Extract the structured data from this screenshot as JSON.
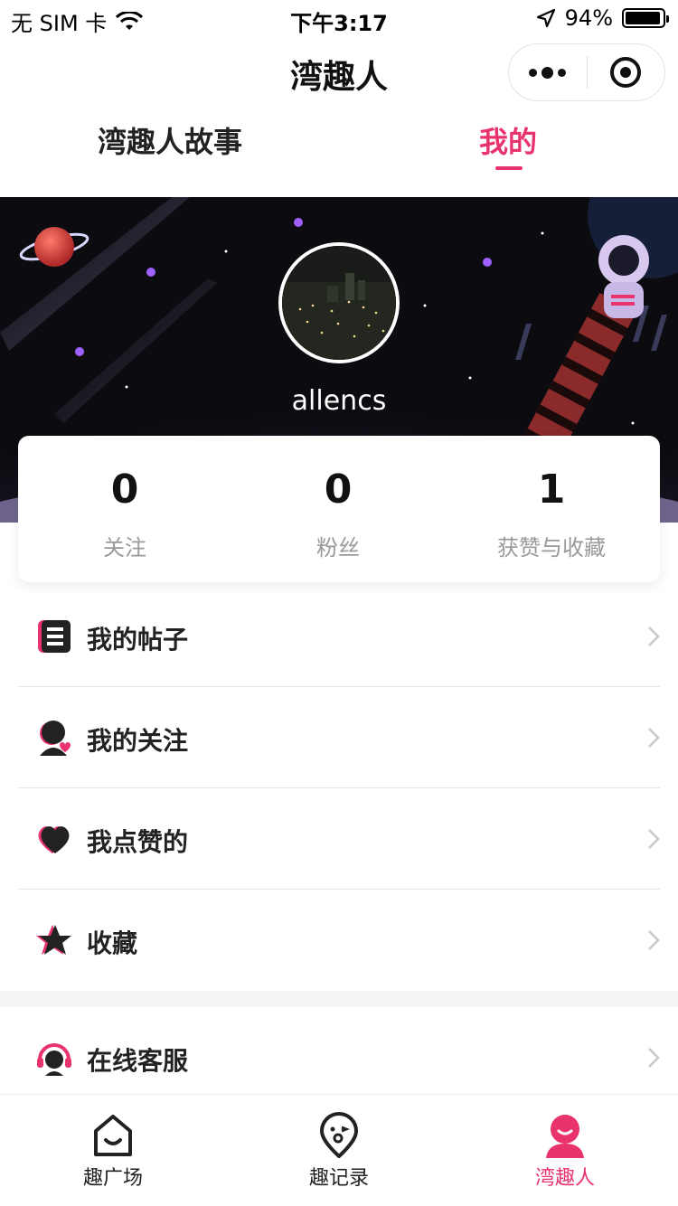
{
  "status_bar": {
    "carrier": "无 SIM 卡",
    "time": "下午3:17",
    "battery_percent": "94%",
    "battery_level": 0.94,
    "icons": [
      "wifi-icon",
      "location-arrow-icon",
      "battery-icon"
    ]
  },
  "header": {
    "title": "湾趣人",
    "capsule_icons": [
      "more-icon",
      "close-target-icon"
    ]
  },
  "tabs": [
    {
      "label": "湾趣人故事",
      "active": false
    },
    {
      "label": "我的",
      "active": true
    }
  ],
  "profile": {
    "username": "allencs",
    "avatar_icon": "city-night-avatar"
  },
  "stats": [
    {
      "value": "0",
      "label": "关注"
    },
    {
      "value": "0",
      "label": "粉丝"
    },
    {
      "value": "1",
      "label": "获赞与收藏"
    }
  ],
  "menu": [
    {
      "label": "我的帖子",
      "icon": "posts-icon"
    },
    {
      "label": "我的关注",
      "icon": "following-icon"
    },
    {
      "label": "我点赞的",
      "icon": "heart-icon"
    },
    {
      "label": "收藏",
      "icon": "star-icon"
    }
  ],
  "service": {
    "label": "在线客服",
    "icon": "headset-icon"
  },
  "tabbar": [
    {
      "label": "趣广场",
      "icon": "home-smile-icon",
      "active": false
    },
    {
      "label": "趣记录",
      "icon": "location-smile-icon",
      "active": false
    },
    {
      "label": "湾趣人",
      "icon": "person-icon",
      "active": true
    }
  ],
  "colors": {
    "accent": "#e8336d",
    "text": "#222222",
    "muted": "#999999",
    "banner_bg": "#0b0b10"
  }
}
